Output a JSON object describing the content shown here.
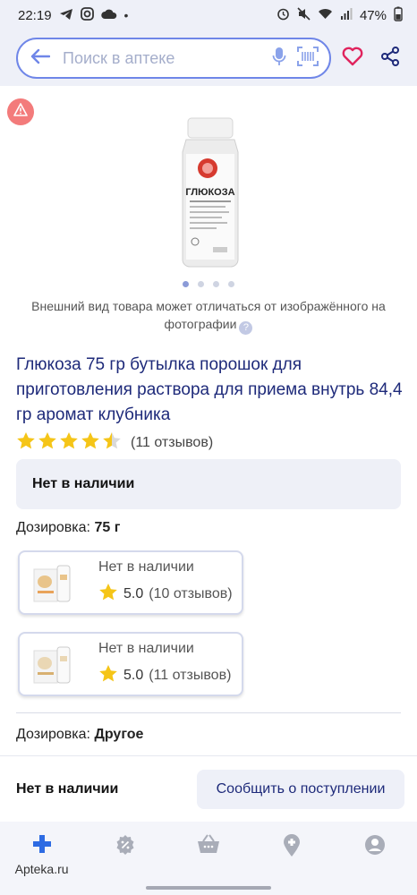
{
  "status_bar": {
    "time": "22:19",
    "battery": "47%"
  },
  "search": {
    "placeholder": "Поиск в аптеке"
  },
  "product": {
    "image_alt": "ГЛЮКОЗА",
    "disclaimer": "Внешний вид товара может отличаться от изображённого на фотографии",
    "help": "?",
    "title": "Глюкоза 75 гр бутылка порошок для приготовления раствора для приема внутрь 84,4 гр аромат клубника",
    "rating": 4.5,
    "reviews": "(11 отзывов)",
    "availability": "Нет в наличии"
  },
  "dosage_1": {
    "label": "Дозировка:",
    "value": "75 г"
  },
  "variants": [
    {
      "status": "Нет в наличии",
      "score": "5.0",
      "count": "(10 отзывов)"
    },
    {
      "status": "Нет в наличии",
      "score": "5.0",
      "count": "(11 отзывов)"
    }
  ],
  "dosage_2": {
    "label": "Дозировка:",
    "value": "Другое"
  },
  "action_bar": {
    "status": "Нет в наличии",
    "notify_label": "Сообщить о поступлении"
  },
  "bottom_nav": {
    "home_label": "Apteka.ru"
  },
  "colors": {
    "accent": "#6f86e8",
    "title": "#1e2a7a",
    "star": "#f5c518",
    "heart": "#e0245e",
    "home_icon": "#2d6be3"
  }
}
